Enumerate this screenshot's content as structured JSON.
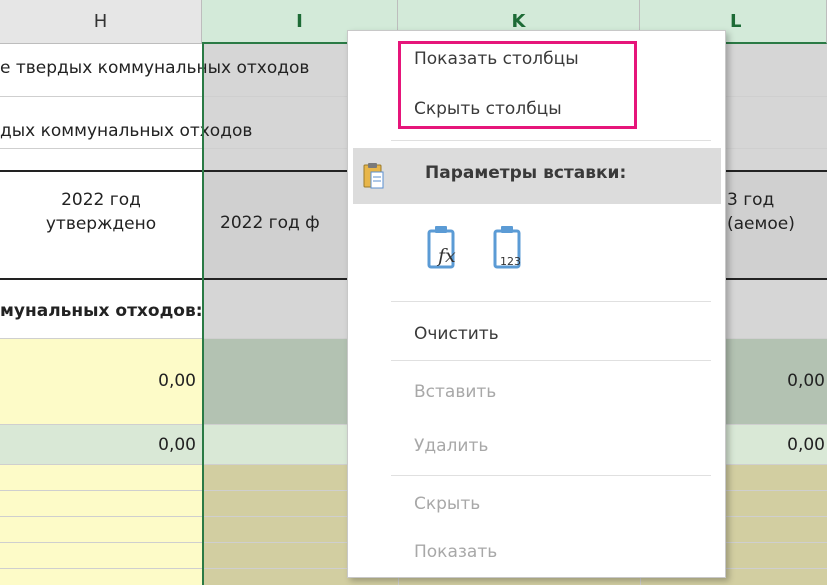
{
  "columns": {
    "h": "H",
    "i": "I",
    "k": "K",
    "l": "L"
  },
  "rows": {
    "r1_h": "е твердых коммунальных отходов",
    "r2_h": "дых коммунальных отходов",
    "r3_h_line1": "2022 год",
    "r3_h_line2": "утверждено",
    "r3_i": "2022 год ф",
    "r3_l_line1": "3 год",
    "r3_l_line2": "(аемое)",
    "r4_h": "мунальных отходов:",
    "r5_h": "0,00",
    "r5_l": "0,00",
    "r6_h": "0,00",
    "r6_l": "0,00"
  },
  "menu": {
    "show_columns": "Показать столбцы",
    "hide_columns": "Скрыть столбцы",
    "paste_options": "Параметры вставки:",
    "paste_fx_sub": "fx",
    "paste_123_sub": "123",
    "clear": "Очистить",
    "insert": "Вставить",
    "delete": "Удалить",
    "hide": "Скрыть",
    "show": "Показать"
  },
  "colors": {
    "highlight_box": "#e6157a",
    "selection": "#2a7a45",
    "yellow_cell": "#fdfbc8",
    "gray_cell": "#d0d0d0",
    "green_cell": "#b3c2b2"
  }
}
